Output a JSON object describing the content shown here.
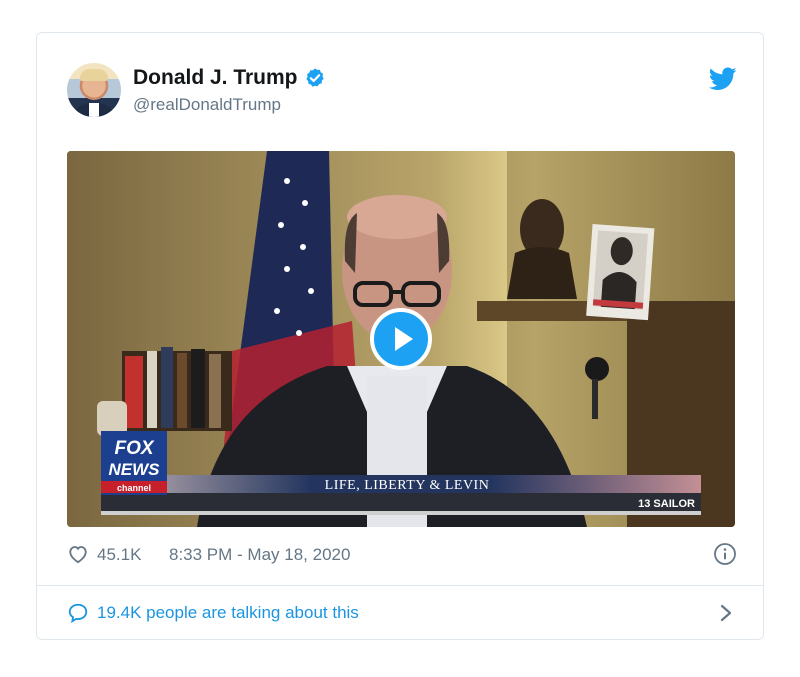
{
  "tweet": {
    "display_name": "Donald J. Trump",
    "handle": "@realDonaldTrump",
    "verified": true,
    "likes": "45.1K",
    "timestamp": "8:33 PM - May 18, 2020",
    "talking": "19.4K people are talking about this"
  },
  "video": {
    "logo_line1": "FOX",
    "logo_line2": "NEWS",
    "logo_line3": "channel",
    "show_title": "LIFE, LIBERTY & LEVIN",
    "lower_third_right": "13 SAILOR"
  },
  "icons": {
    "brand": "twitter-bird-icon",
    "verified": "verified-badge-icon",
    "like": "heart-icon",
    "info": "info-icon",
    "reply": "speech-bubble-icon",
    "more": "chevron-right-icon",
    "play": "play-icon"
  },
  "colors": {
    "twitter_blue": "#1da1f2",
    "link_blue": "#1b95e0",
    "muted_gray": "#657786",
    "border": "#e1e8ed"
  }
}
